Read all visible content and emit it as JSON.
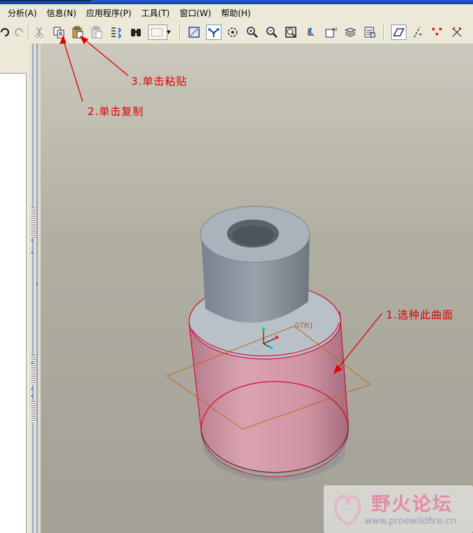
{
  "menubar": {
    "items": [
      "分析(A)",
      "信息(N)",
      "应用程序(P)",
      "工具(T)",
      "窗口(W)",
      "帮助(H)"
    ]
  },
  "toolbar": {
    "buttons": [
      "undo-icon",
      "redo-icon",
      "cut-icon",
      "copy-icon",
      "paste-icon",
      "paste-special-icon",
      "regenerate-icon",
      "find-icon",
      "selection-filter-icon",
      "datum-display-icon",
      "spin-center-icon",
      "orient-icon",
      "zoom-in-icon",
      "zoom-out-icon",
      "refit-icon",
      "reorient-icon",
      "saved-views-icon",
      "layers-icon",
      "view-manager-icon",
      "datum-plane-display-icon",
      "datum-axis-display-icon",
      "datum-point-display-icon",
      "csys-display-icon"
    ]
  },
  "model": {
    "datum_label": "DTM1",
    "surface_color": "#d89aaa",
    "body_color": "#8a939c"
  },
  "annotations": {
    "step1": "1.选种此曲面",
    "step2": "2.单击复制",
    "step3": "3.单击粘贴",
    "color": "#e00000"
  },
  "watermark": {
    "title": "野火论坛",
    "url": "www.proewildfire.cn"
  }
}
